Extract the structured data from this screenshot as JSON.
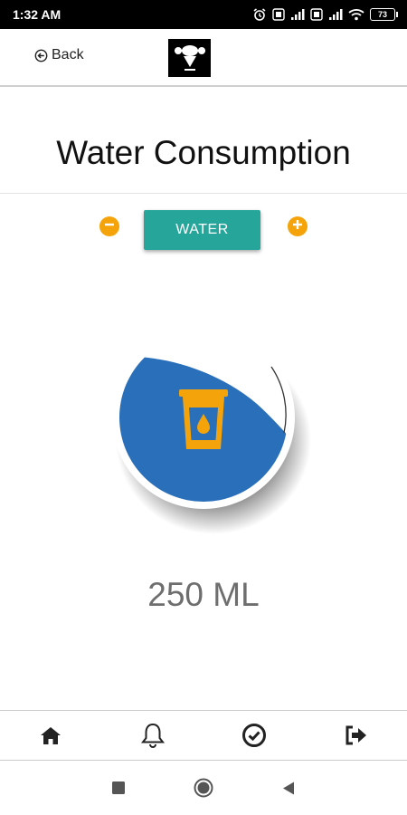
{
  "status_bar": {
    "time": "1:32 AM",
    "battery": "73",
    "icons": [
      "alarm-icon",
      "volte-icon",
      "signal-icon",
      "volte-icon",
      "signal-icon",
      "wifi-icon",
      "battery-icon"
    ]
  },
  "header": {
    "back_label": "Back",
    "logo": "gym-logo"
  },
  "page": {
    "title": "Water Consumption",
    "water_button": "WATER",
    "minus_icon": "minus-circle-icon",
    "plus_icon": "plus-circle-icon"
  },
  "gauge": {
    "icon": "water-glass-icon",
    "fill_color": "#2a6fba",
    "accent_color": "#f5a30b",
    "button_color": "#26a59a",
    "value_text": "250 ML"
  },
  "bottom_nav": {
    "items": [
      "home-icon",
      "bell-icon",
      "check-circle-icon",
      "logout-icon"
    ]
  },
  "system_nav": {
    "items": [
      "recents-square-icon",
      "home-circle-icon",
      "back-triangle-icon"
    ]
  }
}
